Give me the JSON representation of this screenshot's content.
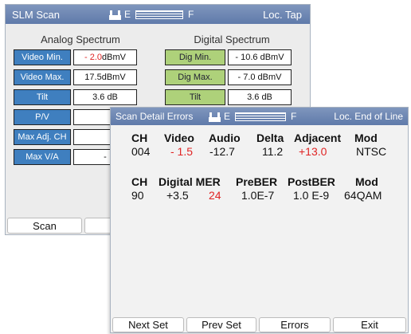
{
  "back_window": {
    "title": "SLM Scan",
    "gauge": {
      "empty_label": "E",
      "full_label": "F"
    },
    "location": "Loc. Tap",
    "analog": {
      "title": "Analog Spectrum",
      "rows": [
        {
          "label": "Video Min.",
          "value": "- 2.0",
          "unit": " dBmV",
          "value_alert": true
        },
        {
          "label": "Video Max.",
          "value": "17.5",
          "unit": " dBmV",
          "value_alert": false
        },
        {
          "label": "Tilt",
          "value": "3.6 dB",
          "unit": "",
          "value_alert": false
        },
        {
          "label": "P/V",
          "value": "",
          "unit": "",
          "value_alert": false
        },
        {
          "label": "Max Adj. CH",
          "value": "",
          "unit": "",
          "value_alert": false
        },
        {
          "label": "Max V/A",
          "value": "-",
          "unit": "",
          "value_alert": false
        }
      ]
    },
    "digital": {
      "title": "Digital Spectrum",
      "rows": [
        {
          "label": "Dig Min.",
          "value": "- 10.6 dBmV"
        },
        {
          "label": "Dig Max.",
          "value": "- 7.0 dBmV"
        },
        {
          "label": "Tilt",
          "value": "3.6 dB"
        }
      ]
    },
    "softkeys": [
      "Scan",
      ""
    ]
  },
  "front_window": {
    "title": "Scan Detail Errors",
    "gauge": {
      "empty_label": "E",
      "full_label": "F"
    },
    "location": "Loc. End of Line",
    "analog_table": {
      "headers": [
        "CH",
        "Video",
        "Audio",
        "Delta",
        "Adjacent",
        "Mod"
      ],
      "row": [
        "004",
        "- 1.5",
        "-12.7",
        "11.2",
        "+13.0",
        "NTSC"
      ],
      "alert_cells": [
        1,
        4
      ]
    },
    "digital_table": {
      "headers": [
        "CH",
        "Digital MER",
        "PreBER",
        "PostBER",
        "Mod"
      ],
      "row": [
        "90",
        "+3.5",
        "24",
        "1.0E-7",
        "1.0 E-9",
        "64QAM"
      ],
      "alert_cells": [
        2
      ]
    },
    "softkeys": [
      "Next Set",
      "Prev Set",
      "Errors",
      "Exit"
    ]
  },
  "colors": {
    "title_bar": "#6d86b4",
    "analog_label": "#3f7fbf",
    "digital_label": "#aed17a",
    "alert": "#e02424"
  }
}
